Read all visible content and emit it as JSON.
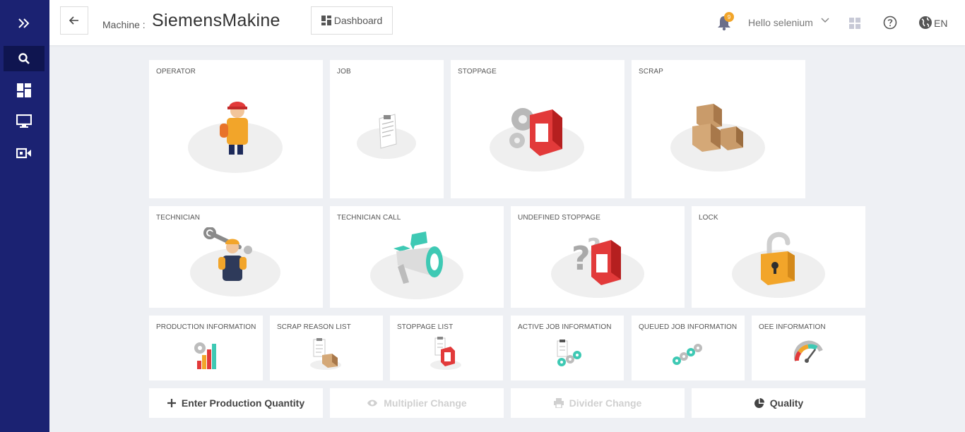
{
  "header": {
    "machine_label": "Machine :",
    "machine_name": "SiemensMakine",
    "dashboard_label": "Dashboard",
    "notification_count": "9",
    "greeting": "Hello selenium",
    "language": "EN"
  },
  "sidebar": {
    "items": [
      {
        "icon": "expand-icon"
      },
      {
        "icon": "search-icon",
        "active": true
      },
      {
        "icon": "dashboard-icon"
      },
      {
        "icon": "monitor-icon"
      },
      {
        "icon": "video-icon"
      }
    ]
  },
  "cards": {
    "operator": "OPERATOR",
    "job": "JOB",
    "stoppage": "STOPPAGE",
    "scrap": "SCRAP",
    "technician": "TECHNICIAN",
    "technician_call": "TECHNICIAN CALL",
    "undefined_stoppage": "UNDEFINED STOPPAGE",
    "lock": "LOCK",
    "production_information": "PRODUCTION INFORMATION",
    "scrap_reason_list": "SCRAP REASON LIST",
    "stoppage_list": "STOPPAGE LIST",
    "active_job_information": "ACTIVE JOB INFORMATION",
    "queued_job_information": "QUEUED JOB INFORMATION",
    "oee_information": "OEE INFORMATION"
  },
  "actions": {
    "enter_production_quantity": "Enter Production Quantity",
    "multiplier_change": "Multiplier Change",
    "divider_change": "Divider Change",
    "quality": "Quality"
  },
  "colors": {
    "sidebar": "#1b2272",
    "accent_red": "#e23a3a",
    "accent_orange": "#f2a52a",
    "accent_teal": "#3ec9b4"
  }
}
